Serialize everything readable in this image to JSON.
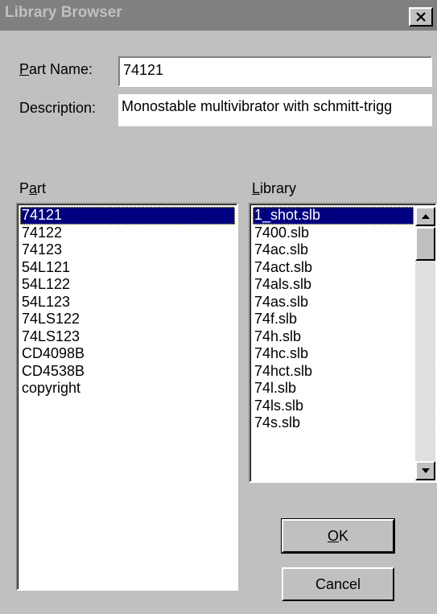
{
  "window": {
    "title": "Library Browser",
    "close_label": "×"
  },
  "part_name": {
    "label": "Part Name:",
    "value": "74121"
  },
  "description": {
    "label": "Description:",
    "value": "Monostable multivibrator with schmitt-trigg"
  },
  "part_list": {
    "label": "Part",
    "selected_index": 0,
    "items": [
      "74121",
      "74122",
      "74123",
      "54L121",
      "54L122",
      "54L123",
      "74LS122",
      "74LS123",
      "CD4098B",
      "CD4538B",
      "copyright"
    ]
  },
  "library_list": {
    "label": "Library",
    "selected_index": 0,
    "items": [
      "1_shot.slb",
      "7400.slb",
      "74ac.slb",
      "74act.slb",
      "74als.slb",
      "74as.slb",
      "74f.slb",
      "74h.slb",
      "74hc.slb",
      "74hct.slb",
      "74l.slb",
      "74ls.slb",
      "74s.slb"
    ],
    "scroll_position": 0
  },
  "buttons": {
    "ok": "OK",
    "cancel": "Cancel"
  },
  "colors": {
    "selection": "#000080",
    "face": "#c0c0c0",
    "title_inactive": "#808080"
  }
}
